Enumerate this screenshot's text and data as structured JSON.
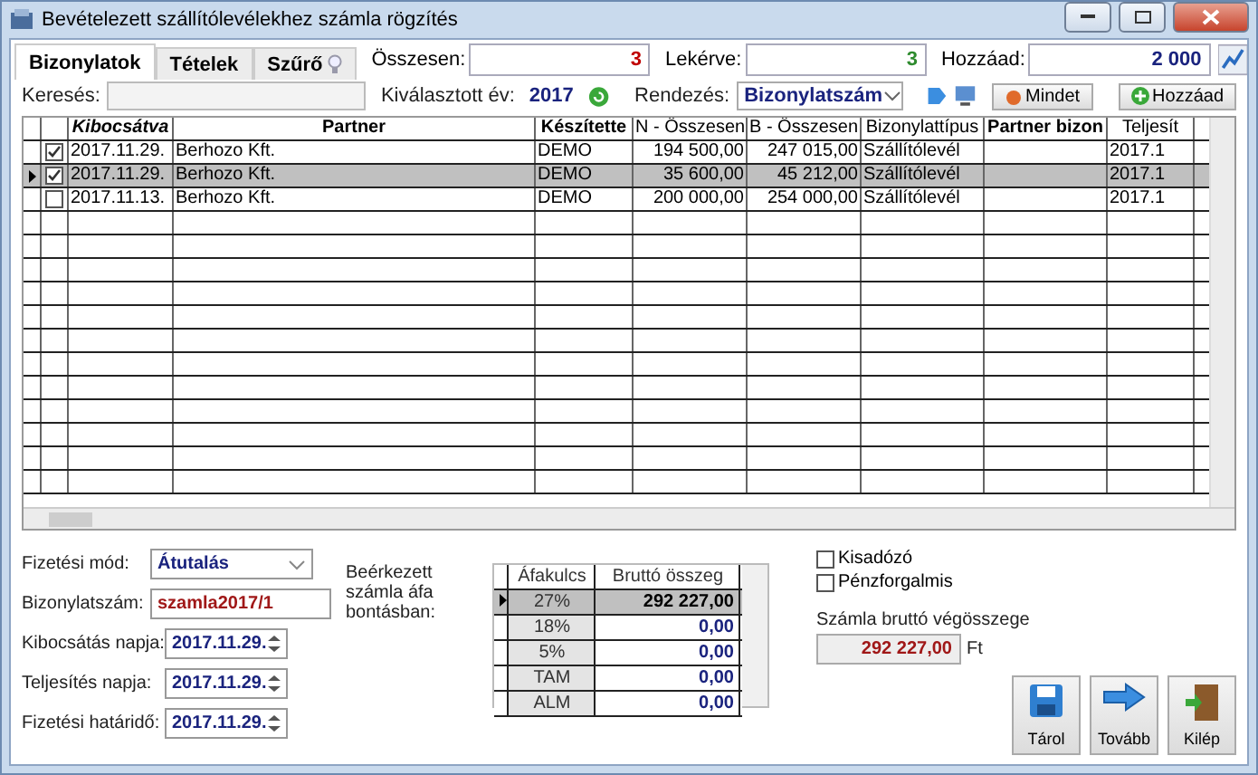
{
  "window": {
    "title": "Bevételezett szállítólevélekhez számla rögzítés"
  },
  "tabs": [
    {
      "label": "Bizonylatok",
      "selected": true
    },
    {
      "label": "Tételek",
      "selected": false
    },
    {
      "label": "Szűrő",
      "selected": false,
      "kind": "bulb"
    }
  ],
  "summary": [
    {
      "label": "Összesen:",
      "value": "3",
      "color": "#c00000"
    },
    {
      "label": "Lekérve:",
      "value": "3",
      "color": "#2e8b2e"
    },
    {
      "label": "Hozzáad:",
      "value": "2 000",
      "color": "#1a237e"
    }
  ],
  "toolbar": {
    "search_label": "Keresés:",
    "year_label": "Kiválasztott év:",
    "year": "2017",
    "sort_label": "Rendezés:",
    "sort_value": "Bizonylatszám",
    "buttons": [
      {
        "label": "Mindet",
        "kind": "all"
      },
      {
        "label": "Hozzáad",
        "kind": "add"
      }
    ]
  },
  "table": {
    "columns": [
      {
        "label": "Kibocsátva",
        "bold": true,
        "italic": true
      },
      {
        "label": "Partner",
        "bold": true,
        "italic": false
      },
      {
        "label": "Készítette",
        "bold": true,
        "italic": false
      },
      {
        "label": "N - Összesen",
        "bold": false,
        "italic": false
      },
      {
        "label": "B - Összesen",
        "bold": false,
        "italic": false
      },
      {
        "label": "Bizonylattípus",
        "bold": false,
        "italic": false
      },
      {
        "label": "Partner bizon",
        "bold": true,
        "italic": false
      },
      {
        "label": "Teljesít",
        "bold": false,
        "italic": false
      }
    ],
    "rows": [
      {
        "checked": true,
        "selected": false,
        "cells": [
          "2017.11.29.",
          "Berhozo Kft.",
          "DEMO",
          "194 500,00",
          "247 015,00",
          "Szállítólevél",
          "",
          "2017.1"
        ]
      },
      {
        "checked": true,
        "selected": true,
        "cells": [
          "2017.11.29.",
          "Berhozo Kft.",
          "DEMO",
          "35 600,00",
          "45 212,00",
          "Szállítólevél",
          "",
          "2017.1"
        ]
      },
      {
        "checked": false,
        "selected": false,
        "cells": [
          "2017.11.13.",
          "Berhozo Kft.",
          "DEMO",
          "200 000,00",
          "254 000,00",
          "Szállítólevél",
          "",
          "2017.1"
        ]
      }
    ]
  },
  "form": {
    "payment_label": "Fizetési mód:",
    "payment": "Átutalás",
    "number_label": "Bizonylatszám:",
    "number": "szamla2017/1",
    "dates": [
      {
        "label": "Kibocsátás napja:",
        "value": "2017.11.29."
      },
      {
        "label": "Teljesítés napja:",
        "value": "2017.11.29."
      },
      {
        "label": "Fizetési határidő:",
        "value": "2017.11.29."
      }
    ]
  },
  "vat": {
    "label": "Beérkezett számla áfa bontásban:",
    "columns": [
      "Áfakulcs",
      "Bruttó összeg"
    ],
    "rows": [
      {
        "rate": "27%",
        "amount": "292 227,00",
        "selected": true
      },
      {
        "rate": "18%",
        "amount": "0,00",
        "selected": false
      },
      {
        "rate": "5%",
        "amount": "0,00",
        "selected": false
      },
      {
        "rate": "TAM",
        "amount": "0,00",
        "selected": false
      },
      {
        "rate": "ALM",
        "amount": "0,00",
        "selected": false
      }
    ]
  },
  "checkboxes": [
    {
      "label": "Kisadózó",
      "checked": false
    },
    {
      "label": "Pénzforgalmis",
      "checked": false
    }
  ],
  "total": {
    "label": "Számla bruttó végösszege",
    "value": "292 227,00",
    "currency": "Ft"
  },
  "actions": [
    {
      "label": "Tárol",
      "kind": "save"
    },
    {
      "label": "Tovább",
      "kind": "next"
    },
    {
      "label": "Kilép",
      "kind": "exit"
    }
  ]
}
